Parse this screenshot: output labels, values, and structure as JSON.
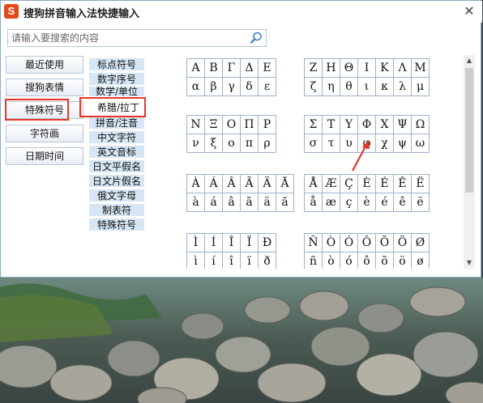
{
  "window": {
    "title": "搜狗拼音输入法快捷输入",
    "logo_letter": "S",
    "close_label": "✕"
  },
  "search": {
    "placeholder": "请输入要搜索的内容",
    "icon": "search-icon"
  },
  "nav": [
    {
      "label": "最近使用"
    },
    {
      "label": "搜狗表情"
    },
    {
      "label": "特殊符号",
      "selected": true
    },
    {
      "label": "字符画"
    },
    {
      "label": "日期时间"
    }
  ],
  "categories": [
    {
      "label": "标点符号"
    },
    {
      "label": "数字序号"
    },
    {
      "label": "数学/单位"
    },
    {
      "label": "希腊/拉丁",
      "selected": true
    },
    {
      "label": "拼音/注音"
    },
    {
      "label": "中文字符"
    },
    {
      "label": "英文音标"
    },
    {
      "label": "日文平假名"
    },
    {
      "label": "日文片假名"
    },
    {
      "label": "俄文字母"
    },
    {
      "label": "制表符"
    },
    {
      "label": "特殊符号"
    }
  ],
  "symbol_blocks": [
    [
      [
        "Α",
        "Β",
        "Γ",
        "Δ",
        "Ε"
      ],
      [
        "α",
        "β",
        "γ",
        "δ",
        "ε"
      ]
    ],
    [
      [
        "Ζ",
        "Η",
        "Θ",
        "Ι",
        "Κ",
        "Λ",
        "Μ"
      ],
      [
        "ζ",
        "η",
        "θ",
        "ι",
        "κ",
        "λ",
        "μ"
      ]
    ],
    [
      [
        "Ν",
        "Ξ",
        "Ο",
        "Π",
        "Ρ"
      ],
      [
        "ν",
        "ξ",
        "ο",
        "π",
        "ρ"
      ]
    ],
    [
      [
        "Σ",
        "Τ",
        "Υ",
        "Φ",
        "Χ",
        "Ψ",
        "Ω"
      ],
      [
        "σ",
        "τ",
        "υ",
        "φ",
        "χ",
        "ψ",
        "ω"
      ]
    ],
    [
      [
        "À",
        "Á",
        "Â",
        "Ã",
        "Ä",
        "Ă"
      ],
      [
        "à",
        "á",
        "â",
        "ã",
        "ä",
        "ă"
      ]
    ],
    [
      [
        "Å",
        "Æ",
        "Ç",
        "È",
        "É",
        "Ê",
        "Ë"
      ],
      [
        "å",
        "æ",
        "ç",
        "è",
        "é",
        "ê",
        "ë"
      ]
    ],
    [
      [
        "Ì",
        "Í",
        "Î",
        "Ï",
        "Ð"
      ],
      [
        "ì",
        "í",
        "î",
        "ï",
        "ð"
      ]
    ],
    [
      [
        "Ñ",
        "Ò",
        "Ó",
        "Ô",
        "Õ",
        "Ö",
        "Ø"
      ],
      [
        "ñ",
        "ò",
        "ó",
        "ô",
        "õ",
        "ö",
        "ø"
      ]
    ]
  ],
  "colors": {
    "highlight": "#e8352b",
    "category_bg": "#d7e6f4",
    "grid_border": "#9eb2cc"
  }
}
